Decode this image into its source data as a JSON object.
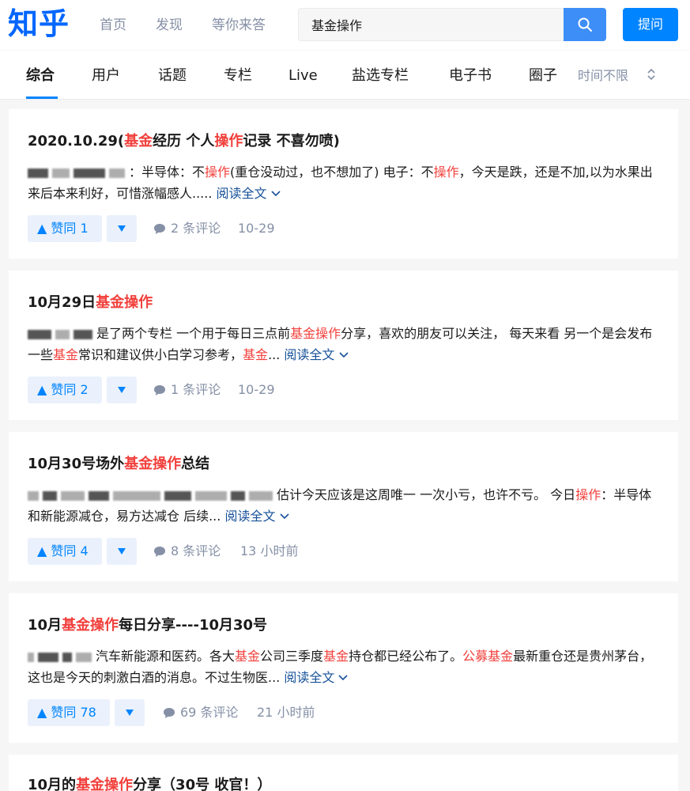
{
  "app": {
    "logo": "知乎"
  },
  "nav": {
    "home": "首页",
    "discover": "发现",
    "waiting": "等你来答"
  },
  "search": {
    "value": "基金操作"
  },
  "ask_button": "提问",
  "tabs": [
    "综合",
    "用户",
    "话题",
    "专栏",
    "Live",
    "盐选专栏",
    "电子书",
    "圈子"
  ],
  "time_filter": "时间不限",
  "colors": {
    "brand": "#0084ff",
    "highlight": "#f1403c",
    "link": "#175199",
    "meta": "#8590a6"
  },
  "results": [
    {
      "title_pre": "2020.10.29(",
      "title_hl1": "基金",
      "title_mid": "经历 个人",
      "title_hl2": "操作",
      "title_post": "记录 不喜勿喷)",
      "ex_a": "：半导体：不",
      "ex_hl1": "操作",
      "ex_b": "(重仓没动过，也不想加了) 电子：不",
      "ex_hl2": "操作",
      "ex_c": "，今天是跌，还是不加,以为水果出来后本来利好，可惜涨幅感人.....",
      "read_more": "阅读全文",
      "votes": "赞同 1",
      "comments": "2 条评论",
      "time": "10-29"
    },
    {
      "title_pre": "10月29日",
      "title_hl": "基金操作",
      "ex_a": "是了两个专栏 一个用于每日三点前",
      "ex_hl1": "基金操作",
      "ex_b": "分享，喜欢的朋友可以关注， 每天来看 另一个是会发布一些",
      "ex_hl2": "基金",
      "ex_c": "常识和建议供小白学习参考，",
      "ex_hl3": "基金",
      "ex_d": "...",
      "read_more": "阅读全文",
      "votes": "赞同 2",
      "comments": "1 条评论",
      "time": "10-29"
    },
    {
      "title_pre": "10月30号场外",
      "title_hl": "基金操作",
      "title_post": "总结",
      "ex_a": "估计今天应该是这周唯一 一次小亏，也许不亏。 今日",
      "ex_hl1": "操作",
      "ex_b": "：半导体和新能源减仓，易方达减仓 后续...",
      "read_more": "阅读全文",
      "votes": "赞同 4",
      "comments": "8 条评论",
      "time": "13 小时前"
    },
    {
      "title_pre": "10月",
      "title_hl": "基金操作",
      "title_post": "每日分享----10月30号",
      "ex_a": "汽车新能源和医药。各大",
      "ex_hl1": "基金",
      "ex_b": "公司三季度",
      "ex_hl2": "基金",
      "ex_c": "持仓都已经公布了。",
      "ex_hl3": "公募基金",
      "ex_d": "最新重仓还是贵州茅台，这也是今天的刺激白酒的消息。不过生物医...",
      "read_more": "阅读全文",
      "votes": "赞同 78",
      "comments": "69 条评论",
      "time": "21 小时前"
    },
    {
      "title_pre": "10月的",
      "title_hl": "基金操作",
      "title_post": "分享（30号 收官！）"
    }
  ]
}
